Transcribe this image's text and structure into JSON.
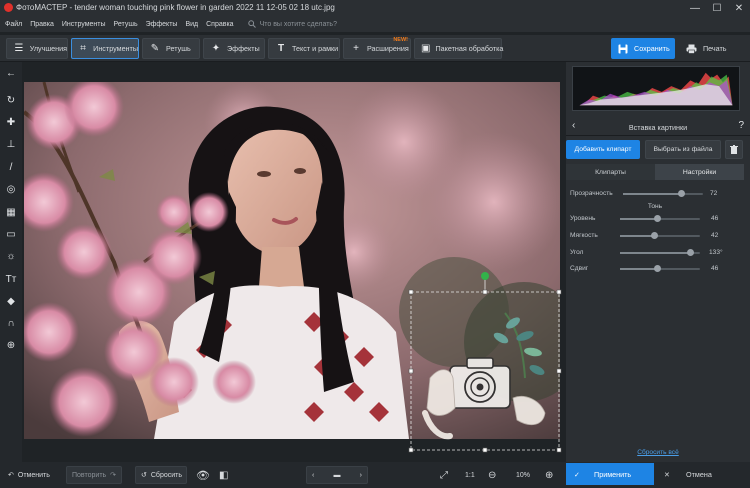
{
  "window": {
    "title": "ФотоМАСТЕР - tender woman touching pink flower in garden 2022 11 12-05 02 18 utc.jpg",
    "controls": [
      "minimize-icon",
      "maximize-icon",
      "close-icon"
    ]
  },
  "menu": {
    "items": [
      "Файл",
      "Правка",
      "Инструменты",
      "Ретушь",
      "Эффекты",
      "Вид",
      "Справка"
    ],
    "search_placeholder": "Что вы хотите сделать?"
  },
  "toolbar": {
    "tabs": [
      {
        "label": "Улучшения",
        "icon": "sliders-icon"
      },
      {
        "label": "Инструменты",
        "icon": "crop-icon",
        "active": true
      },
      {
        "label": "Ретушь",
        "icon": "brush-icon"
      },
      {
        "label": "Эффекты",
        "icon": "magic-wand-icon"
      },
      {
        "label": "Текст и рамки",
        "icon": "text-icon"
      },
      {
        "label": "Расширения",
        "icon": "plus-icon",
        "badge": "NEW!"
      },
      {
        "label": "Пакетная обработка",
        "icon": "batch-icon"
      }
    ],
    "save_label": "Сохранить",
    "print_label": "Печать"
  },
  "left_tools": [
    "back-arrow-icon",
    "rotate-icon",
    "bandage-icon",
    "stamp-icon",
    "brush-icon",
    "circle-target-icon",
    "gradient-icon",
    "vignette-icon",
    "sun-icon",
    "text-tool-icon",
    "fill-icon",
    "horseshoe-magnet-icon",
    "globe-icon"
  ],
  "panel": {
    "title": "Вставка картинки",
    "add_clipart_label": "Добавить клипарт",
    "choose_file_label": "Выбрать из файла",
    "tabs": [
      "Клипарты",
      "Настройки"
    ],
    "active_tab": "Настройки",
    "tone_heading": "Тонь",
    "sliders": [
      {
        "label": "Прозрачность",
        "value": "72",
        "level": 0.72
      },
      {
        "label": "Уровень",
        "value": "46",
        "level": 0.46
      },
      {
        "label": "Мягкость",
        "value": "42",
        "level": 0.42
      },
      {
        "label": "Угол",
        "value": "133°",
        "level": 0.87
      },
      {
        "label": "Сдвиг",
        "value": "46",
        "level": 0.46
      }
    ],
    "reset_label": "Сбросить всё"
  },
  "bottom": {
    "undo_label": "Отменить",
    "redo_label": "Повторить",
    "reset_label": "Сбросить",
    "ratio_label": "1:1",
    "zoom_value": "10%",
    "apply_label": "Применить",
    "cancel_label": "Отмена"
  },
  "colors": {
    "accent": "#1e84e4",
    "badge": "#f07a1a",
    "handle": "#33b34a"
  }
}
